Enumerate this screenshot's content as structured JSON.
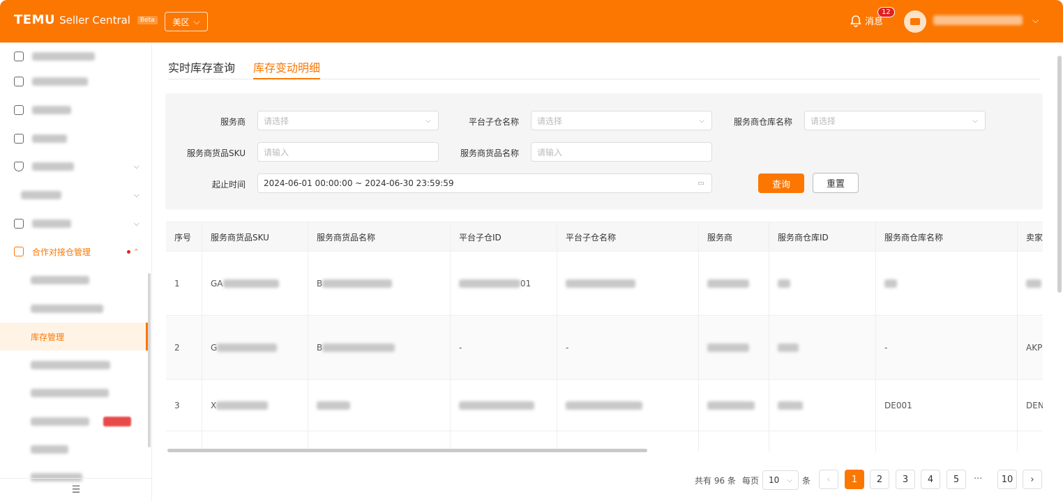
{
  "header": {
    "brand": "TEMU",
    "product": "Seller Central",
    "beta": "Beta",
    "region": "美区",
    "messages_label": "消息",
    "messages_count": "12"
  },
  "sidebar": {
    "group_label": "合作对接仓管理",
    "active_sub": "库存管理"
  },
  "tabs": [
    "实时库存查询",
    "库存变动明细"
  ],
  "filters": {
    "provider_label": "服务商",
    "provider_placeholder": "请选择",
    "sub_warehouse_label": "平台子仓名称",
    "sub_warehouse_placeholder": "请选择",
    "provider_wh_label": "服务商仓库名称",
    "provider_wh_placeholder": "请选择",
    "sku_label": "服务商货品SKU",
    "sku_placeholder": "请输入",
    "goods_name_label": "服务商货品名称",
    "goods_name_placeholder": "请输入",
    "time_label": "起止时间",
    "time_value": "2024-06-01 00:00:00 ~ 2024-06-30 23:59:59",
    "search_btn": "查询",
    "reset_btn": "重置"
  },
  "table": {
    "columns": [
      "序号",
      "服务商货品SKU",
      "服务商货品名称",
      "平台子仓ID",
      "平台子仓名称",
      "服务商",
      "服务商仓库ID",
      "服务商仓库名称",
      "卖家"
    ],
    "rows": [
      {
        "no": "1",
        "sku": "GA",
        "name": "B",
        "sub_id": "01",
        "sub_name": "",
        "provider": "",
        "wh_id": "",
        "wh_name": "",
        "seller": ""
      },
      {
        "no": "2",
        "sku": "G",
        "name": "B",
        "sub_id": "-",
        "sub_name": "-",
        "provider": "",
        "wh_id": "",
        "wh_name": "-",
        "seller": "AKP"
      },
      {
        "no": "3",
        "sku": "X",
        "name": "",
        "sub_id": "",
        "sub_name": "",
        "provider": "",
        "wh_id": "",
        "wh_name": "DE001",
        "seller": "DEN"
      }
    ]
  },
  "pagination": {
    "total_text": "共有 96 条",
    "per_page_label": "每页",
    "per_page": "10",
    "unit": "条",
    "pages": [
      "1",
      "2",
      "3",
      "4",
      "5"
    ],
    "ellipsis": "···",
    "last": "10",
    "current": "1"
  }
}
